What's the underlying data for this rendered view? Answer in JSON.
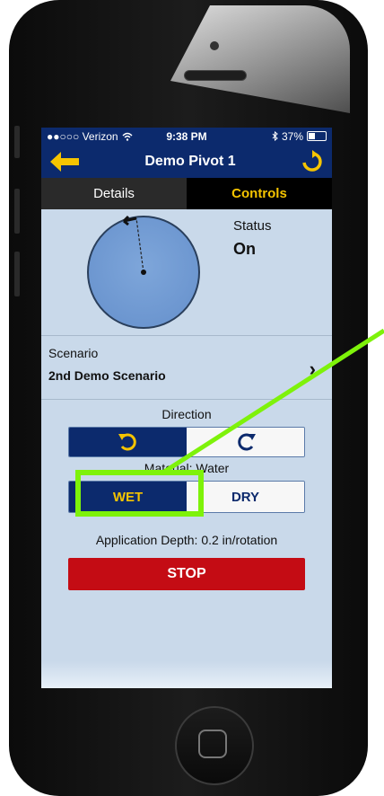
{
  "status_bar": {
    "carrier": "●●○○○ Verizon",
    "time": "9:38 PM",
    "battery": "37%"
  },
  "nav": {
    "title": "Demo Pivot 1",
    "back_icon": "back-arrow-icon",
    "refresh_icon": "refresh-icon"
  },
  "tabs": [
    {
      "label": "Details"
    },
    {
      "label": "Controls"
    }
  ],
  "status": {
    "label": "Status",
    "value": "On"
  },
  "scenario": {
    "label": "Scenario",
    "value": "2nd Demo Scenario"
  },
  "direction": {
    "label": "Direction",
    "active": "reverse"
  },
  "material": {
    "label": "Material: Water",
    "wet": "WET",
    "dry": "DRY",
    "selected": "WET"
  },
  "application": {
    "label": "Application Depth: 0.2 in/rotation"
  },
  "stop": {
    "label": "STOP"
  },
  "colors": {
    "accent": "#f5c400",
    "navy": "#0c2a6d",
    "stop_red": "#c40c14",
    "highlight_green": "#7ef20a"
  }
}
